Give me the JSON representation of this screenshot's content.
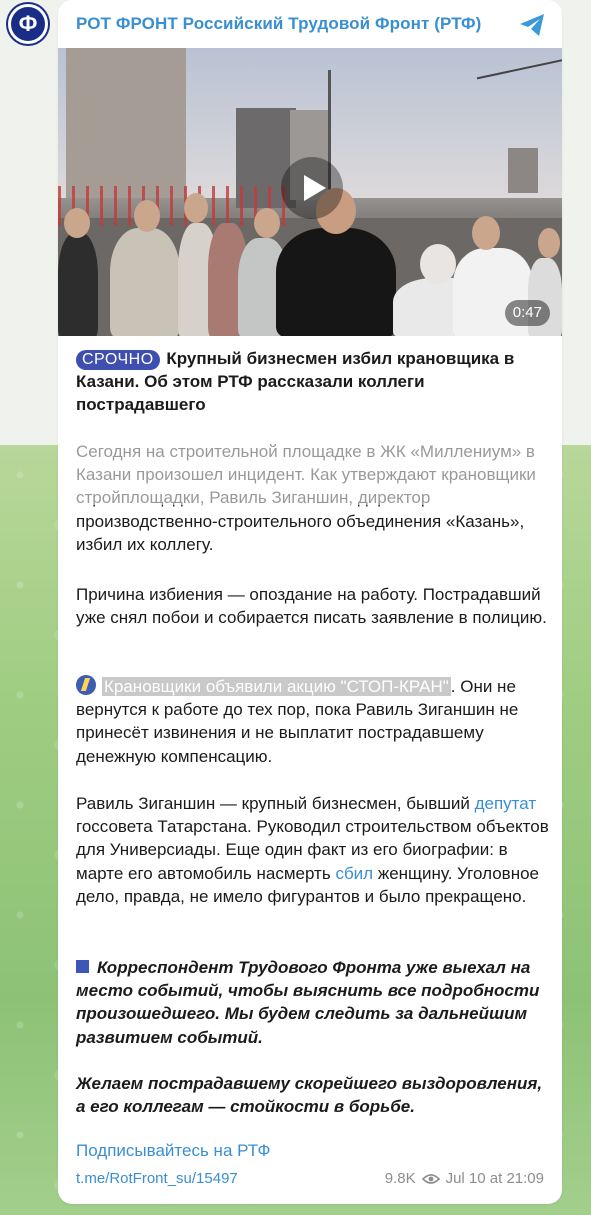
{
  "channel": {
    "avatar_letter": "Ф",
    "name": "РОТ ФРОНТ Российский Трудовой Фронт (РТФ)"
  },
  "video": {
    "duration": "0:47"
  },
  "post": {
    "badge": "СРОЧНО",
    "headline": "Крупный бизнесмен избил крановщика в Казани. Об этом РТФ рассказали коллеги пострадавшего",
    "para1": "Сегодня на строительной площадке в ЖК «Миллениум» в Казани произошел инцидент. Как утверждают крановщики стройплощадки, Равиль Зиганшин, директор производственно-строительного объединения «Казань», избил их коллегу.",
    "para2": "Причина избиения — опоздание на работу. Пострадавший уже снял побои и собирается писать заявление в полицию.",
    "para3_highlight": "Крановщики объявили акцию \"СТОП-КРАН\"",
    "para3_rest": ". Они не вернутся к работе до тех пор, пока Равиль Зиганшин не принесёт извинения и не выплатит пострадавшему денежную компенсацию.",
    "para4_a": "Равиль Зиганшин — крупный бизнесмен, бывший ",
    "para4_link1": "депутат",
    "para4_b": " госсовета Татарстана. Руководил строительством объектов для Универсиады. Еще один факт из его биографии: в марте его автомобиль насмерть ",
    "para4_link2": "сбил",
    "para4_c": " женщину. Уголовное дело, правда, не имело фигурантов и было прекращено.",
    "para5": "Корреспондент Трудового Фронта уже выехал на место событий, чтобы выяснить все подробности произошедшего. Мы будем следить за дальнейшим развитием событий.",
    "para6": "Желаем пострадавшему скорейшего выздоровления, а его коллегам — стойкости в борьбе.",
    "subscribe": "Подписывайтесь на РТФ",
    "post_link": "t.me/RotFront_su/15497",
    "views": "9.8K",
    "date": "Jul 10 at 21:09"
  },
  "colors": {
    "link": "#3a8fd0",
    "badge_bg": "#3f4fb0",
    "avatar_bg": "#1a2d86"
  },
  "icons": [
    "share-icon",
    "play-icon",
    "bolt-icon",
    "square-icon",
    "eye-icon"
  ]
}
